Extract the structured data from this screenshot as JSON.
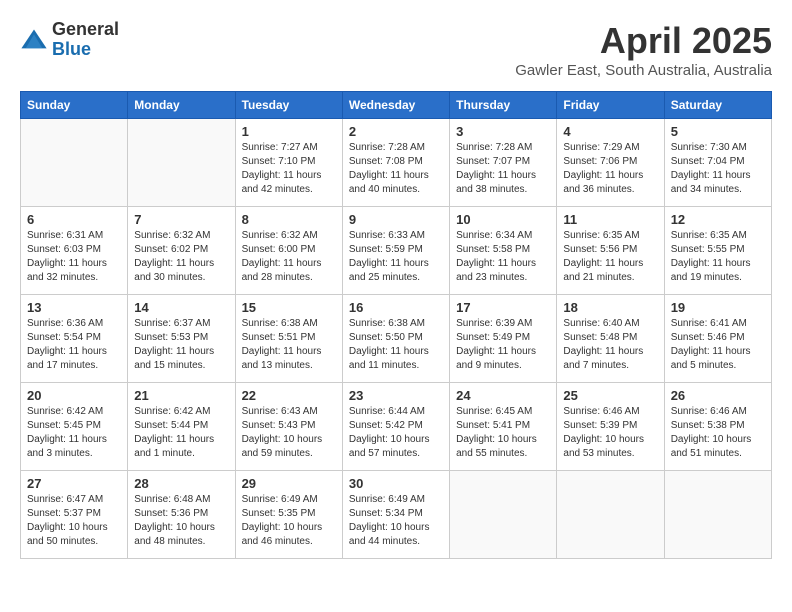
{
  "logo": {
    "general": "General",
    "blue": "Blue"
  },
  "title": {
    "month": "April 2025",
    "location": "Gawler East, South Australia, Australia"
  },
  "headers": [
    "Sunday",
    "Monday",
    "Tuesday",
    "Wednesday",
    "Thursday",
    "Friday",
    "Saturday"
  ],
  "weeks": [
    [
      {
        "day": "",
        "sunrise": "",
        "sunset": "",
        "daylight": ""
      },
      {
        "day": "",
        "sunrise": "",
        "sunset": "",
        "daylight": ""
      },
      {
        "day": "1",
        "sunrise": "Sunrise: 7:27 AM",
        "sunset": "Sunset: 7:10 PM",
        "daylight": "Daylight: 11 hours and 42 minutes."
      },
      {
        "day": "2",
        "sunrise": "Sunrise: 7:28 AM",
        "sunset": "Sunset: 7:08 PM",
        "daylight": "Daylight: 11 hours and 40 minutes."
      },
      {
        "day": "3",
        "sunrise": "Sunrise: 7:28 AM",
        "sunset": "Sunset: 7:07 PM",
        "daylight": "Daylight: 11 hours and 38 minutes."
      },
      {
        "day": "4",
        "sunrise": "Sunrise: 7:29 AM",
        "sunset": "Sunset: 7:06 PM",
        "daylight": "Daylight: 11 hours and 36 minutes."
      },
      {
        "day": "5",
        "sunrise": "Sunrise: 7:30 AM",
        "sunset": "Sunset: 7:04 PM",
        "daylight": "Daylight: 11 hours and 34 minutes."
      }
    ],
    [
      {
        "day": "6",
        "sunrise": "Sunrise: 6:31 AM",
        "sunset": "Sunset: 6:03 PM",
        "daylight": "Daylight: 11 hours and 32 minutes."
      },
      {
        "day": "7",
        "sunrise": "Sunrise: 6:32 AM",
        "sunset": "Sunset: 6:02 PM",
        "daylight": "Daylight: 11 hours and 30 minutes."
      },
      {
        "day": "8",
        "sunrise": "Sunrise: 6:32 AM",
        "sunset": "Sunset: 6:00 PM",
        "daylight": "Daylight: 11 hours and 28 minutes."
      },
      {
        "day": "9",
        "sunrise": "Sunrise: 6:33 AM",
        "sunset": "Sunset: 5:59 PM",
        "daylight": "Daylight: 11 hours and 25 minutes."
      },
      {
        "day": "10",
        "sunrise": "Sunrise: 6:34 AM",
        "sunset": "Sunset: 5:58 PM",
        "daylight": "Daylight: 11 hours and 23 minutes."
      },
      {
        "day": "11",
        "sunrise": "Sunrise: 6:35 AM",
        "sunset": "Sunset: 5:56 PM",
        "daylight": "Daylight: 11 hours and 21 minutes."
      },
      {
        "day": "12",
        "sunrise": "Sunrise: 6:35 AM",
        "sunset": "Sunset: 5:55 PM",
        "daylight": "Daylight: 11 hours and 19 minutes."
      }
    ],
    [
      {
        "day": "13",
        "sunrise": "Sunrise: 6:36 AM",
        "sunset": "Sunset: 5:54 PM",
        "daylight": "Daylight: 11 hours and 17 minutes."
      },
      {
        "day": "14",
        "sunrise": "Sunrise: 6:37 AM",
        "sunset": "Sunset: 5:53 PM",
        "daylight": "Daylight: 11 hours and 15 minutes."
      },
      {
        "day": "15",
        "sunrise": "Sunrise: 6:38 AM",
        "sunset": "Sunset: 5:51 PM",
        "daylight": "Daylight: 11 hours and 13 minutes."
      },
      {
        "day": "16",
        "sunrise": "Sunrise: 6:38 AM",
        "sunset": "Sunset: 5:50 PM",
        "daylight": "Daylight: 11 hours and 11 minutes."
      },
      {
        "day": "17",
        "sunrise": "Sunrise: 6:39 AM",
        "sunset": "Sunset: 5:49 PM",
        "daylight": "Daylight: 11 hours and 9 minutes."
      },
      {
        "day": "18",
        "sunrise": "Sunrise: 6:40 AM",
        "sunset": "Sunset: 5:48 PM",
        "daylight": "Daylight: 11 hours and 7 minutes."
      },
      {
        "day": "19",
        "sunrise": "Sunrise: 6:41 AM",
        "sunset": "Sunset: 5:46 PM",
        "daylight": "Daylight: 11 hours and 5 minutes."
      }
    ],
    [
      {
        "day": "20",
        "sunrise": "Sunrise: 6:42 AM",
        "sunset": "Sunset: 5:45 PM",
        "daylight": "Daylight: 11 hours and 3 minutes."
      },
      {
        "day": "21",
        "sunrise": "Sunrise: 6:42 AM",
        "sunset": "Sunset: 5:44 PM",
        "daylight": "Daylight: 11 hours and 1 minute."
      },
      {
        "day": "22",
        "sunrise": "Sunrise: 6:43 AM",
        "sunset": "Sunset: 5:43 PM",
        "daylight": "Daylight: 10 hours and 59 minutes."
      },
      {
        "day": "23",
        "sunrise": "Sunrise: 6:44 AM",
        "sunset": "Sunset: 5:42 PM",
        "daylight": "Daylight: 10 hours and 57 minutes."
      },
      {
        "day": "24",
        "sunrise": "Sunrise: 6:45 AM",
        "sunset": "Sunset: 5:41 PM",
        "daylight": "Daylight: 10 hours and 55 minutes."
      },
      {
        "day": "25",
        "sunrise": "Sunrise: 6:46 AM",
        "sunset": "Sunset: 5:39 PM",
        "daylight": "Daylight: 10 hours and 53 minutes."
      },
      {
        "day": "26",
        "sunrise": "Sunrise: 6:46 AM",
        "sunset": "Sunset: 5:38 PM",
        "daylight": "Daylight: 10 hours and 51 minutes."
      }
    ],
    [
      {
        "day": "27",
        "sunrise": "Sunrise: 6:47 AM",
        "sunset": "Sunset: 5:37 PM",
        "daylight": "Daylight: 10 hours and 50 minutes."
      },
      {
        "day": "28",
        "sunrise": "Sunrise: 6:48 AM",
        "sunset": "Sunset: 5:36 PM",
        "daylight": "Daylight: 10 hours and 48 minutes."
      },
      {
        "day": "29",
        "sunrise": "Sunrise: 6:49 AM",
        "sunset": "Sunset: 5:35 PM",
        "daylight": "Daylight: 10 hours and 46 minutes."
      },
      {
        "day": "30",
        "sunrise": "Sunrise: 6:49 AM",
        "sunset": "Sunset: 5:34 PM",
        "daylight": "Daylight: 10 hours and 44 minutes."
      },
      {
        "day": "",
        "sunrise": "",
        "sunset": "",
        "daylight": ""
      },
      {
        "day": "",
        "sunrise": "",
        "sunset": "",
        "daylight": ""
      },
      {
        "day": "",
        "sunrise": "",
        "sunset": "",
        "daylight": ""
      }
    ]
  ]
}
